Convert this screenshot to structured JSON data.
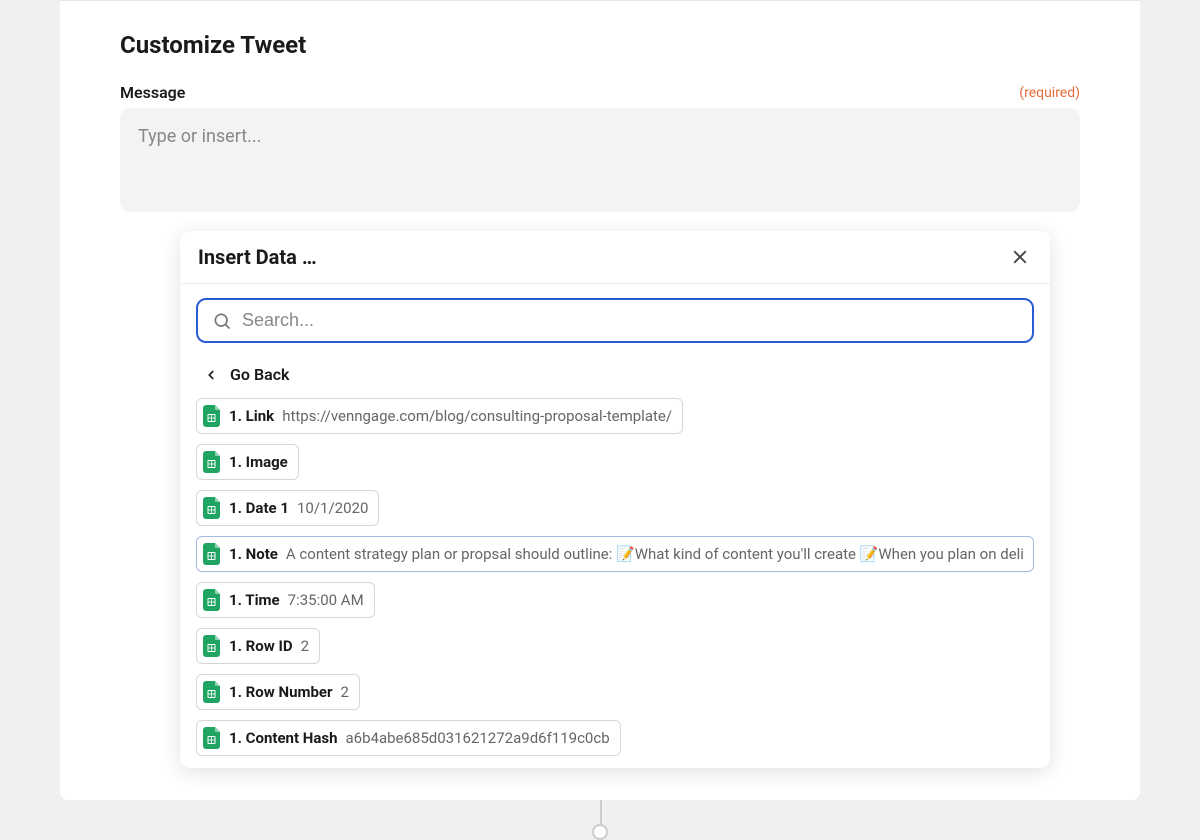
{
  "page_title": "Customize Tweet",
  "message": {
    "label": "Message",
    "required_text": "(required)",
    "placeholder": "Type or insert..."
  },
  "insert_panel": {
    "title": "Insert Data …",
    "search_placeholder": "Search...",
    "go_back": "Go Back",
    "items": [
      {
        "label": "1. Link",
        "value": "https://venngage.com/blog/consulting-proposal-template/"
      },
      {
        "label": "1. Image",
        "value": ""
      },
      {
        "label": "1. Date 1",
        "value": "10/1/2020"
      },
      {
        "label": "1. Note",
        "value": "A content strategy plan or propsal should outline: 📝What kind of content you'll create 📝When you plan on delivering the cont"
      },
      {
        "label": "1. Time",
        "value": "7:35:00 AM"
      },
      {
        "label": "1. Row ID",
        "value": "2"
      },
      {
        "label": "1. Row Number",
        "value": "2"
      },
      {
        "label": "1. Content Hash",
        "value": "a6b4abe685d031621272a9d6f119c0cb"
      }
    ]
  }
}
